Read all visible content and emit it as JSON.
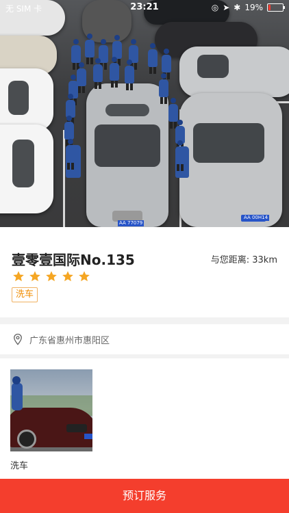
{
  "status_bar": {
    "carrier": "无 SIM 卡",
    "time": "23:21",
    "battery": "19%"
  },
  "shop": {
    "name": "壹零壹国际No.135",
    "distance": "与您距离: 33km",
    "rating": 5,
    "tag": "洗车"
  },
  "address": {
    "text": "广东省惠州市惠阳区"
  },
  "services": [
    {
      "label": "洗车"
    }
  ],
  "hero_plates": [
    "AA 77079",
    "AA 00H14"
  ],
  "bottom_button": {
    "label": "预订服务"
  },
  "colors": {
    "accent": "#f43e2d",
    "star": "#f5a623",
    "tag": "#f08c00"
  }
}
